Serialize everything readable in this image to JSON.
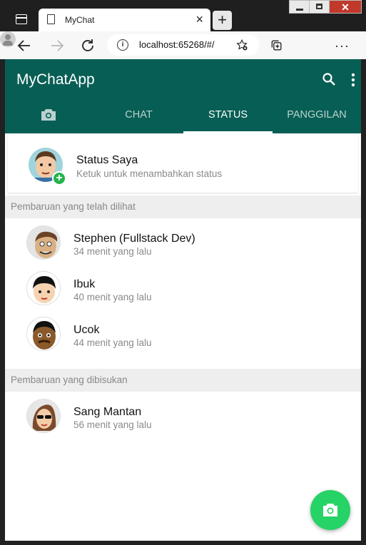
{
  "browser": {
    "tab_title": "MyChat",
    "tab_close": "×",
    "new_tab": "+",
    "url": "localhost:65268/#/",
    "window_close": "✕",
    "menu": "···"
  },
  "app": {
    "title": "MyChatApp",
    "tabs": [
      {
        "label": "CHAT"
      },
      {
        "label": "STATUS",
        "active": true
      },
      {
        "label": "PANGGILAN"
      }
    ],
    "my_status": {
      "name": "Status Saya",
      "subtitle": "Ketuk untuk menambahkan status",
      "badge": "+"
    },
    "sections": {
      "viewed": "Pembaruan yang telah dilihat",
      "muted": "Pembaruan yang dibisukan"
    },
    "viewed_updates": [
      {
        "name": "Stephen (Fullstack Dev)",
        "time": "34 menit yang lalu"
      },
      {
        "name": "Ibuk",
        "time": "40 menit yang lalu"
      },
      {
        "name": "Ucok",
        "time": "44 menit yang lalu"
      }
    ],
    "muted_updates": [
      {
        "name": "Sang Mantan",
        "time": "56 menit yang lalu"
      }
    ],
    "colors": {
      "primary": "#075e54",
      "accent": "#25d366"
    }
  }
}
